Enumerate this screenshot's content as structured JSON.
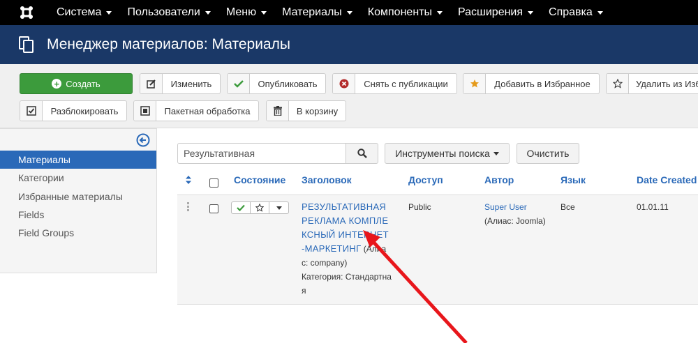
{
  "navbar": {
    "items": [
      {
        "label": "Система"
      },
      {
        "label": "Пользователи"
      },
      {
        "label": "Меню"
      },
      {
        "label": "Материалы"
      },
      {
        "label": "Компоненты"
      },
      {
        "label": "Расширения"
      },
      {
        "label": "Справка"
      }
    ]
  },
  "header": {
    "title": "Менеджер материалов: Материалы"
  },
  "toolbar": {
    "create": "Создать",
    "edit": "Изменить",
    "publish": "Опубликовать",
    "unpublish": "Снять с публикации",
    "feature": "Добавить в Избранное",
    "unfeature": "Удалить из Избранного",
    "checkin": "Разблокировать",
    "batch": "Пакетная обработка",
    "trash": "В корзину"
  },
  "sidebar": {
    "items": [
      {
        "label": "Материалы",
        "active": true
      },
      {
        "label": "Категории"
      },
      {
        "label": "Избранные материалы"
      },
      {
        "label": "Fields"
      },
      {
        "label": "Field Groups"
      }
    ]
  },
  "filters": {
    "search_value": "Результативная",
    "search_tools": "Инструменты поиска",
    "clear": "Очистить"
  },
  "table": {
    "headers": {
      "status": "Состояние",
      "title": "Заголовок",
      "access": "Доступ",
      "author": "Автор",
      "language": "Язык",
      "date": "Date Created"
    },
    "rows": [
      {
        "title_lines": [
          "РЕЗУЛЬТАТИВНАЯ",
          "РЕКЛАМА КОМПЛЕ",
          "КСНЫЙ ИНТЕРНЕТ",
          "-МАРКЕТИНГ"
        ],
        "alias_part1": " (Алиа",
        "alias_part2": "с: company)",
        "category_label": "Категория: ",
        "category_part1": "Стандартна",
        "category_part2": "я",
        "access": "Public",
        "author": "Super User",
        "author_alias": "(Алиас: Joomla)",
        "language": "Все",
        "date": "01.01.11"
      }
    ]
  },
  "colors": {
    "navbar": "#000000",
    "header": "#1a3867",
    "create_button": "#3c9b3c",
    "accent": "#2a69b8",
    "annotation_arrow": "#e8161b"
  }
}
